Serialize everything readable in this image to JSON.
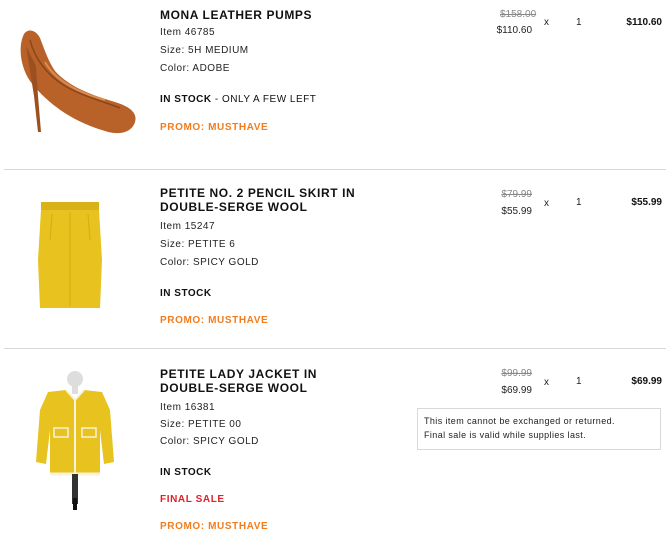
{
  "items": [
    {
      "name": "MONA LEATHER PUMPS",
      "item": "Item 46785",
      "size": "Size: 5H MEDIUM",
      "color": "Color: ADOBE",
      "stock_bold": "IN STOCK",
      "stock_rest": " - ONLY A FEW LEFT",
      "promo": "PROMO: MUSTHAVE",
      "was_price": "$158.00",
      "price": "$110.60",
      "times": "x",
      "qty": "1",
      "total": "$110.60"
    },
    {
      "name_line1": "PETITE NO. 2 PENCIL SKIRT IN",
      "name_line2": "DOUBLE-SERGE WOOL",
      "item": "Item 15247",
      "size": "Size: PETITE 6",
      "color": "Color: SPICY GOLD",
      "stock_bold": "IN STOCK",
      "promo": "PROMO: MUSTHAVE",
      "was_price": "$79.99",
      "price": "$55.99",
      "times": "x",
      "qty": "1",
      "total": "$55.99"
    },
    {
      "name_line1": "PETITE LADY JACKET IN",
      "name_line2": "DOUBLE-SERGE WOOL",
      "item": "Item 16381",
      "size": "Size: PETITE 00",
      "color": "Color: SPICY GOLD",
      "stock_bold": "IN STOCK",
      "final_sale": "FINAL SALE",
      "promo": "PROMO: MUSTHAVE",
      "was_price": "$99.99",
      "price": "$69.99",
      "times": "x",
      "qty": "1",
      "total": "$69.99",
      "notice_line1": "This item cannot be exchanged or returned.",
      "notice_line2": "Final sale is valid while supplies last."
    }
  ],
  "colors": {
    "promo": "#f27d1f",
    "final_sale": "#e0202a",
    "product_leather": "#b8622a",
    "product_gold": "#e8c21f"
  }
}
